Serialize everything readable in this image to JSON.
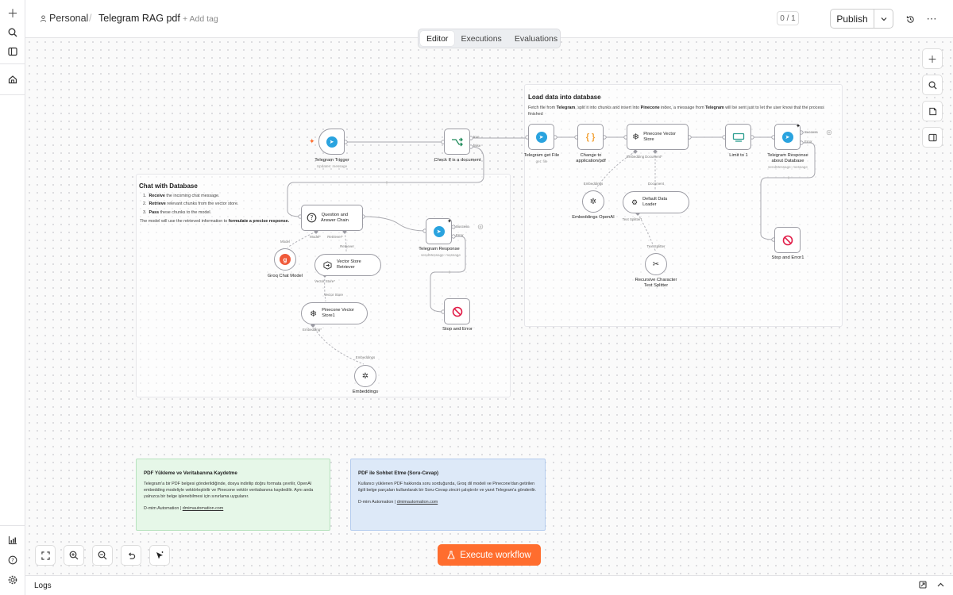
{
  "header": {
    "project": "Personal",
    "separator": "/",
    "workflow_name": "Telegram RAG pdf",
    "add_tag": "+ Add tag",
    "counter": "0 / 1",
    "publish": "Publish"
  },
  "tabs": [
    {
      "label": "Editor",
      "active": true
    },
    {
      "label": "Executions",
      "active": false
    },
    {
      "label": "Evaluations",
      "active": false
    }
  ],
  "groups": {
    "load": {
      "title": "Load data into database",
      "desc_1": "Fetch file from ",
      "desc_b1": "Telegram",
      "desc_2": ", split it into chunks and insert into ",
      "desc_b2": "Pinecone",
      "desc_3": " index, a message from ",
      "desc_b3": "Telegram",
      "desc_4": " will be sent just to let the user know that the process finished"
    },
    "chat": {
      "title": "Chat with Database",
      "items": [
        {
          "bold": "Receive",
          "text": " the incoming chat message."
        },
        {
          "bold": "Retrieve",
          "text": " relevant chunks from the vector store."
        },
        {
          "bold": "Pass",
          "text": " these chunks to the model."
        }
      ],
      "footer_1": "The model will use the retrieved information to ",
      "footer_b": "formulate a precise response."
    }
  },
  "nodes": {
    "telegram_trigger": {
      "label": "Telegram Trigger",
      "sub": "Updates: message"
    },
    "check_doc": {
      "label": "Check If is a document",
      "out_true": "true",
      "out_false": "false"
    },
    "tg_get_file": {
      "label": "Telegram get File",
      "sub": "get: file"
    },
    "change_pdf": {
      "label_1": "Change to",
      "label_2": "application/pdf"
    },
    "pinecone_store": {
      "label_1": "Pinecone Vector",
      "label_2": "Store",
      "port": "Embedding",
      "port2": "Document*"
    },
    "limit": {
      "label": "Limit to 1"
    },
    "tg_resp_db": {
      "label_1": "Telegram Response",
      "label_2": "about Database",
      "sub": "sendMessage: message",
      "out_success": "Success",
      "out_error": "Error"
    },
    "embeddings_openai": {
      "label": "Embeddings OpenAI",
      "port": "Embeddings"
    },
    "default_loader": {
      "label": "Default Data Loader",
      "port_in": "Document",
      "port_out": "Text Splitter*"
    },
    "text_splitter": {
      "label_1": "Recursive Character",
      "label_2": "Text Splitter",
      "port": "Text Splitter"
    },
    "stop_error1": {
      "label": "Stop and Error1"
    },
    "qa_chain": {
      "label_1": "Question and",
      "label_2": "Answer Chain",
      "port_model": "Model*",
      "port_retriever": "Retriever*"
    },
    "tg_response": {
      "label": "Telegram Response",
      "sub": "sendMessage: message",
      "out_success": "Success",
      "out_error": "Error"
    },
    "groq": {
      "label": "Groq Chat Model",
      "port": "Model"
    },
    "retriever": {
      "label_1": "Vector Store",
      "label_2": "Retriever",
      "port_in": "Retriever",
      "port_out": "Vector Store*"
    },
    "pinecone_store1": {
      "label_1": "Pinecone Vector",
      "label_2": "Store1",
      "port_in": "Vector Store",
      "port_out": "Embedding*"
    },
    "embeddings": {
      "label": "Embeddings",
      "port": "Embeddings"
    },
    "stop_error": {
      "label": "Stop and Error"
    }
  },
  "stickies": {
    "green": {
      "title": "PDF Yükleme ve Veritabanına Kaydetme",
      "body": "Telegram'a bir PDF belgesi gönderildiğinde, dosya indirilip doğru formata çevrilir, OpenAI embedding modeliyle vektörleştirilir ve Pinecone vektör veritabanına kaydedilir. Aynı anda yalnızca bir belge işlenebilmesi için sınırlama uygulanır.",
      "footer_1": "D-mim Automation | ",
      "footer_link": "dmimautomation.com",
      "color": "#e6f7e8"
    },
    "blue": {
      "title": "PDF ile Sohbet Etme (Soru-Cevap)",
      "body": "Kullanıcı yüklenen PDF hakkında soru sorduğunda, Groq dil modeli ve Pinecone'dan getirilen ilgili belge parçaları kullanılarak bir Soru-Cevap zinciri çalıştırılır ve yanıt Telegram'a gönderilir.",
      "footer_1": "D-mim Automation | ",
      "footer_link": "dmimautomation.com",
      "color": "#dde9f8"
    }
  },
  "execute": "Execute workflow",
  "logs": "Logs",
  "colors": {
    "accent": "#ff6d2e",
    "telegram": "#2aa3df",
    "stop": "#e11d48",
    "groq": "#f05a3a",
    "connector": "#a8a8ae"
  }
}
